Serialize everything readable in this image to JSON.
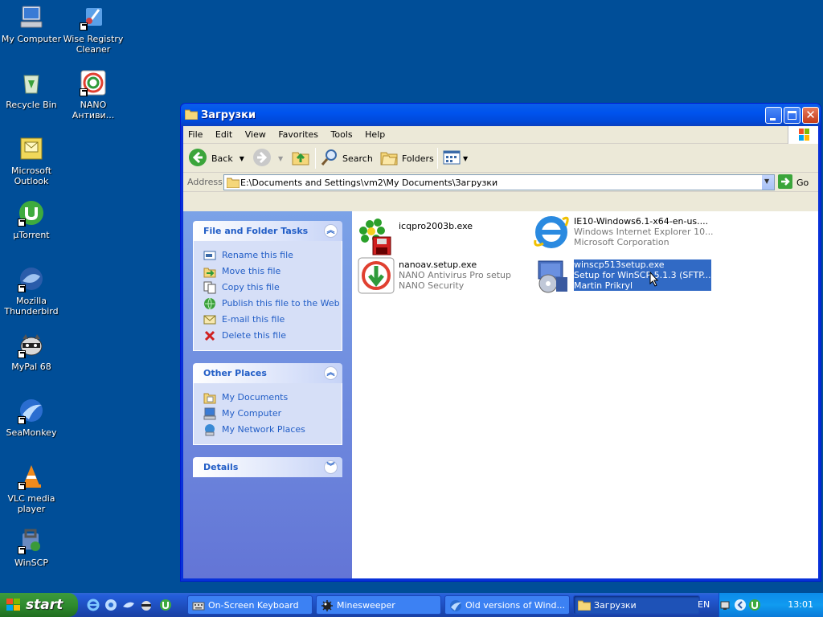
{
  "desktop": {
    "icons": [
      {
        "label": "My Computer"
      },
      {
        "label": "Wise Registry Cleaner"
      },
      {
        "label": "Recycle Bin"
      },
      {
        "label": "NANO Антиви..."
      },
      {
        "label": "Microsoft Outlook"
      },
      {
        "label": "µTorrent"
      },
      {
        "label": "Mozilla Thunderbird"
      },
      {
        "label": "MyPal 68"
      },
      {
        "label": "SeaMonkey"
      },
      {
        "label": "VLC media player"
      },
      {
        "label": "WinSCP"
      }
    ]
  },
  "window": {
    "title": "Загрузки",
    "menu": [
      "File",
      "Edit",
      "View",
      "Favorites",
      "Tools",
      "Help"
    ],
    "toolbar": {
      "back": "Back",
      "search": "Search",
      "folders": "Folders"
    },
    "address": {
      "label": "Address",
      "path": "E:\\Documents and Settings\\vm2\\My Documents\\Загрузки",
      "go": "Go"
    },
    "tasks": {
      "file_folder": {
        "title": "File and Folder Tasks",
        "items": [
          "Rename this file",
          "Move this file",
          "Copy this file",
          "Publish this file to the Web",
          "E-mail this file",
          "Delete this file"
        ]
      },
      "other_places": {
        "title": "Other Places",
        "items": [
          "My Documents",
          "My Computer",
          "My Network Places"
        ]
      },
      "details": {
        "title": "Details"
      }
    },
    "files": [
      {
        "name": "icqpro2003b.exe",
        "desc": "",
        "company": "",
        "icon": "icq-icon"
      },
      {
        "name": "IE10-Windows6.1-x64-en-us....",
        "desc": "Windows Internet Explorer 10...",
        "company": "Microsoft Corporation",
        "icon": "ie-icon"
      },
      {
        "name": "nanoav.setup.exe",
        "desc": "NANO Antivirus Pro setup",
        "company": "NANO Security",
        "icon": "nano-icon"
      },
      {
        "name": "winscp513setup.exe",
        "desc": "Setup for WinSCP 5.1.3 (SFTP...",
        "company": "Martin Prikryl",
        "icon": "installer-icon",
        "selected": true
      }
    ]
  },
  "taskbar": {
    "start": "start",
    "buttons": [
      {
        "label": "On-Screen Keyboard"
      },
      {
        "label": "Minesweeper"
      },
      {
        "label": "Old versions of Wind..."
      },
      {
        "label": "Загрузки",
        "active": true
      }
    ],
    "lang": "EN",
    "clock": "13:01"
  },
  "colors": {
    "desktop": "#004e98",
    "title_bar": "#0053ee",
    "task_link": "#215dc6",
    "selection": "#316ac5",
    "start_green": "#2f8c2f"
  }
}
